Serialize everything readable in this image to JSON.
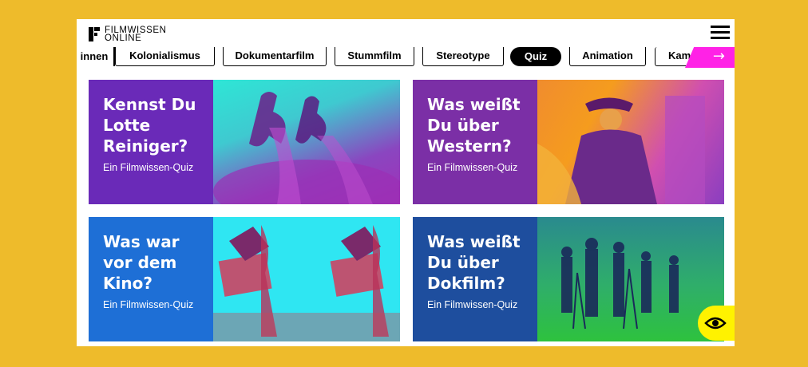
{
  "logo": {
    "line1": "FILMWISSEN",
    "line2": "ONLINE"
  },
  "menu_icon": "hamburger-menu-icon",
  "tags": [
    "innen",
    "Kolonialismus",
    "Dokumentarfilm",
    "Stummfilm",
    "Stereotype",
    "Quiz",
    "Animation",
    "Kam"
  ],
  "active_tag": "Quiz",
  "next_arrow": "→",
  "colors": {
    "background": "#EEBB2B",
    "accent_pink": "#FF22E6",
    "eye_button": "#FFF200"
  },
  "cards": [
    {
      "title": "Kennst Du\nLotte\nReiniger?",
      "subtitle": "Ein Filmwissen-Quiz",
      "panel_color": "#6A2AB8"
    },
    {
      "title": "Was weißt\nDu über\nWestern?",
      "subtitle": "Ein Filmwissen-Quiz",
      "panel_color": "#7B2FA6"
    },
    {
      "title": "Was war\nvor dem\nKino?",
      "subtitle": "Ein Filmwissen-Quiz",
      "panel_color": "#1E6FD6"
    },
    {
      "title": "Was weißt\nDu über\nDokfilm?",
      "subtitle": "Ein Filmwissen-Quiz",
      "panel_color": "#1E4E9E"
    }
  ],
  "accessibility_icon": "eye-icon"
}
